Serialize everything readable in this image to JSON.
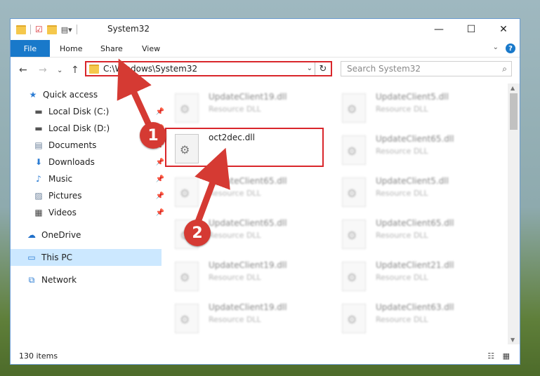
{
  "window": {
    "title": "System32",
    "controls": {
      "minimize": "—",
      "maximize": "☐",
      "close": "✕"
    }
  },
  "ribbon": {
    "tabs": [
      "File",
      "Home",
      "Share",
      "View"
    ],
    "help": "?",
    "expand": "⌄"
  },
  "navigation": {
    "back": "←",
    "forward": "→",
    "recent": "⌄",
    "up": "↑",
    "address": "C:\\Windows\\System32",
    "address_dropdown": "⌄",
    "refresh": "↻",
    "search_placeholder": "Search System32",
    "search_icon": "⌕"
  },
  "sidebar": {
    "items": [
      {
        "label": "Quick access",
        "icon": "★"
      },
      {
        "label": "Local Disk (C:)",
        "icon": "▬"
      },
      {
        "label": "Local Disk (D:)",
        "icon": "▬"
      },
      {
        "label": "Documents",
        "icon": "▤"
      },
      {
        "label": "Downloads",
        "icon": "⬇"
      },
      {
        "label": "Music",
        "icon": "♪"
      },
      {
        "label": "Pictures",
        "icon": "▨"
      },
      {
        "label": "Videos",
        "icon": "▦"
      },
      {
        "label": "OneDrive",
        "icon": "☁"
      },
      {
        "label": "This PC",
        "icon": "▭"
      },
      {
        "label": "Network",
        "icon": "⧉"
      }
    ],
    "pin": "📌"
  },
  "files": {
    "left_column": [
      {
        "name": "UpdateClient19.dll",
        "type": "Resource DLL"
      },
      {
        "name": "UpdateClient65.dll",
        "type": "Resource DLL"
      },
      {
        "name": "UpdateClient65.dll",
        "type": "Resource DLL"
      },
      {
        "name": "UpdateClient19.dll",
        "type": "Resource DLL"
      },
      {
        "name": "UpdateClient19.dll",
        "type": "Resource DLL"
      }
    ],
    "right_column": [
      {
        "name": "UpdateClient5.dll",
        "type": "Resource DLL"
      },
      {
        "name": "UpdateClient65.dll",
        "type": "Resource DLL"
      },
      {
        "name": "UpdateClient5.dll",
        "type": "Resource DLL"
      },
      {
        "name": "UpdateClient65.dll",
        "type": "Resource DLL"
      },
      {
        "name": "UpdateClient21.dll",
        "type": "Resource DLL"
      },
      {
        "name": "UpdateClient63.dll",
        "type": "Resource DLL"
      }
    ],
    "highlighted": {
      "name": "oct2dec.dll"
    }
  },
  "status": {
    "count": "130 items",
    "views": "☷ ▦"
  },
  "markers": [
    "1",
    "2"
  ],
  "colors": {
    "accent": "#1979ca",
    "highlight": "#d9262b",
    "marker": "#d53a33"
  }
}
